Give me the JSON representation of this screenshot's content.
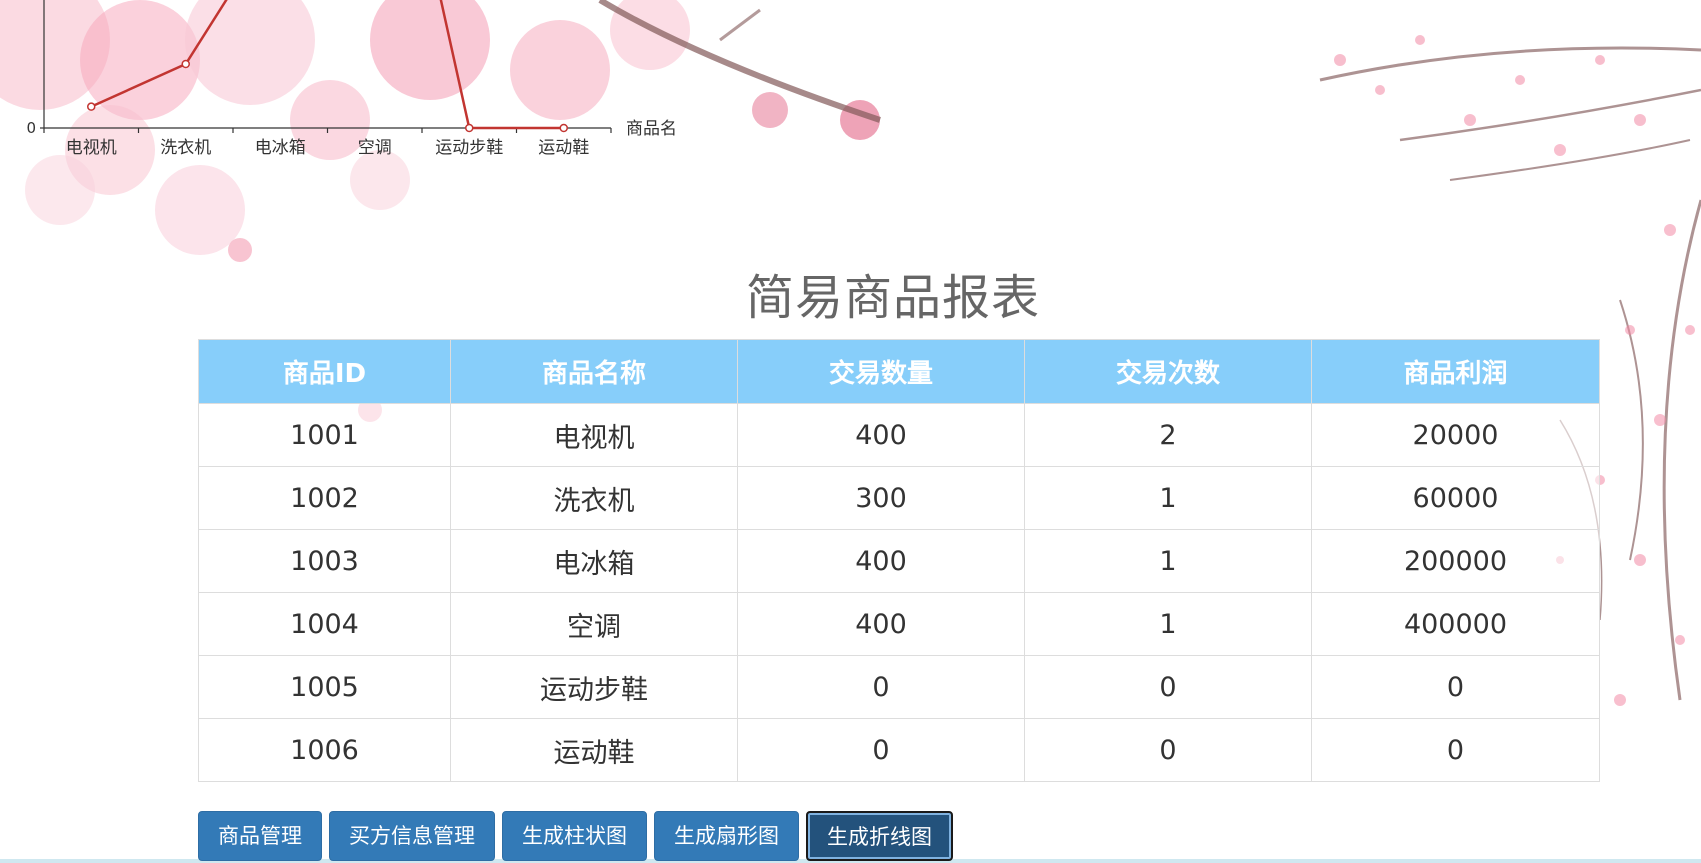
{
  "chart_data": {
    "type": "line",
    "categories": [
      "电视机",
      "洗衣机",
      "电冰箱",
      "空调",
      "运动步鞋",
      "运动鞋"
    ],
    "xlabel": "商品名",
    "y_tick_labels": [
      "0"
    ],
    "series": [
      {
        "values": [
          20000,
          60000,
          200000,
          400000,
          0,
          0
        ]
      }
    ],
    "colors": {
      "line": "#c23531",
      "axis": "#333333"
    }
  },
  "report": {
    "title": "简易商品报表",
    "columns": [
      "商品ID",
      "商品名称",
      "交易数量",
      "交易次数",
      "商品利润"
    ],
    "rows": [
      [
        "1001",
        "电视机",
        "400",
        "2",
        "20000"
      ],
      [
        "1002",
        "洗衣机",
        "300",
        "1",
        "60000"
      ],
      [
        "1003",
        "电冰箱",
        "400",
        "1",
        "200000"
      ],
      [
        "1004",
        "空调",
        "400",
        "1",
        "400000"
      ],
      [
        "1005",
        "运动步鞋",
        "0",
        "0",
        "0"
      ],
      [
        "1006",
        "运动鞋",
        "0",
        "0",
        "0"
      ]
    ]
  },
  "buttons": {
    "manage_goods": "商品管理",
    "manage_buyers": "买方信息管理",
    "bar_chart": "生成柱状图",
    "pie_chart": "生成扇形图",
    "line_chart": "生成折线图"
  },
  "theme": {
    "header_bg": "#87cefa",
    "button_bg": "#337ab7",
    "button_active_bg": "#23527c",
    "blossom_pink": "#f28aa5",
    "branch_brown": "#6b3b3b"
  }
}
